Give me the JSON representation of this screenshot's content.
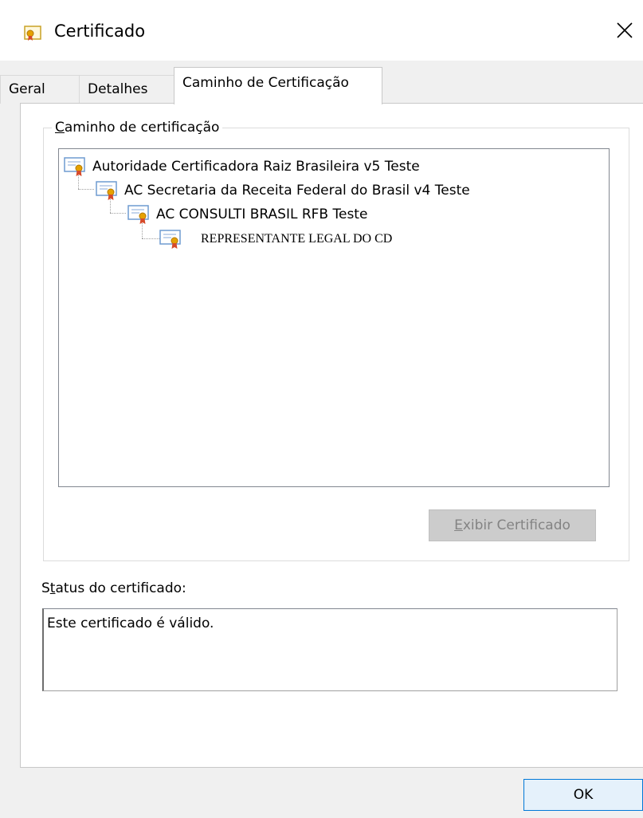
{
  "window": {
    "title": "Certificado",
    "title_icon": "certificate-icon",
    "close_icon": "close-icon"
  },
  "tabs": [
    {
      "label": "Geral",
      "active": false
    },
    {
      "label": "Detalhes",
      "active": false
    },
    {
      "label": "Caminho de Certificação",
      "active": true
    }
  ],
  "path_group": {
    "legend_first": "C",
    "legend_rest": "aminho de certificação",
    "nodes": [
      {
        "label": "Autoridade Certificadora Raiz Brasileira v5 Teste",
        "level": 0
      },
      {
        "label": "AC Secretaria da Receita Federal do Brasil v4 Teste",
        "level": 1
      },
      {
        "label": "AC CONSULTI BRASIL RFB Teste",
        "level": 2
      },
      {
        "label": "REPRESENTANTE LEGAL DO CD",
        "level": 3
      }
    ],
    "view_button": {
      "first": "E",
      "rest": "xibir Certificado",
      "disabled": true
    }
  },
  "status": {
    "label_pre": "S",
    "label_u": "t",
    "label_post": "atus do certificado:",
    "text": "Este certificado é válido."
  },
  "ok_button": "OK",
  "colors": {
    "accent": "#0078d7",
    "cert_icon_gold": "#e6a100",
    "cert_icon_blue": "#6f9bd1"
  }
}
